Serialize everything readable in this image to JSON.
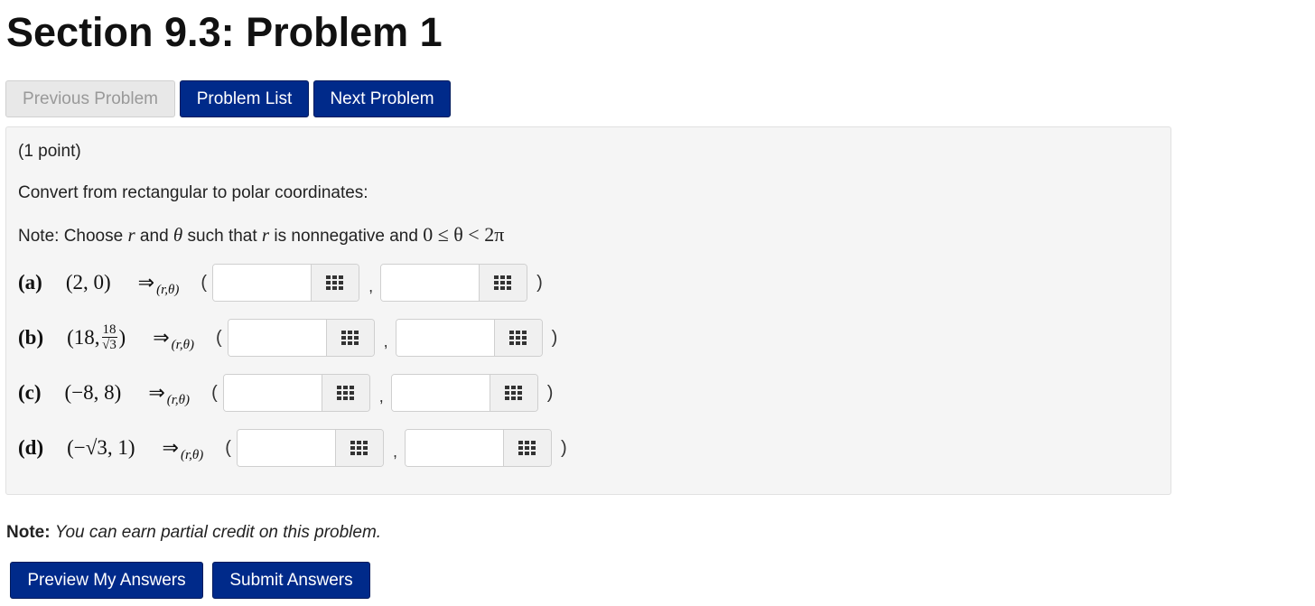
{
  "page": {
    "title": "Section 9.3: Problem 1"
  },
  "nav": {
    "previous_label": "Previous Problem",
    "list_label": "Problem List",
    "next_label": "Next Problem"
  },
  "problem": {
    "points": "(1 point)",
    "instruction": "Convert from rectangular to polar coordinates:",
    "note_prefix": "Note: Choose ",
    "var_r": "r",
    "and_text": " and ",
    "var_theta": "θ",
    "such_that": " such that ",
    "nonneg_text": " is nonnegative and ",
    "condition": "0 ≤ θ < 2π",
    "arrow": "⇒",
    "arrow_sub": "(r,θ)",
    "open_paren": "(",
    "comma": ",",
    "close_paren": ")",
    "parts": [
      {
        "label": "(a)",
        "point": "(2, 0)",
        "answer_r": "",
        "answer_theta": ""
      },
      {
        "label": "(b)",
        "point_start": "(18, ",
        "frac_num": "18",
        "frac_den": "√3",
        "point_end": ")",
        "answer_r": "",
        "answer_theta": ""
      },
      {
        "label": "(c)",
        "point": "(−8, 8)",
        "answer_r": "",
        "answer_theta": ""
      },
      {
        "label": "(d)",
        "point": "(−√3, 1)",
        "answer_r": "",
        "answer_theta": ""
      }
    ]
  },
  "footer": {
    "note_label": "Note:",
    "note_text": "You can earn partial credit on this problem.",
    "preview_label": "Preview My Answers",
    "submit_label": "Submit Answers"
  },
  "colors": {
    "primary_button": "#002a8a",
    "disabled_button": "#e8e8e8",
    "problem_background": "#f5f5f5"
  },
  "icons": {
    "equation_editor": "keypad-grid-icon"
  }
}
